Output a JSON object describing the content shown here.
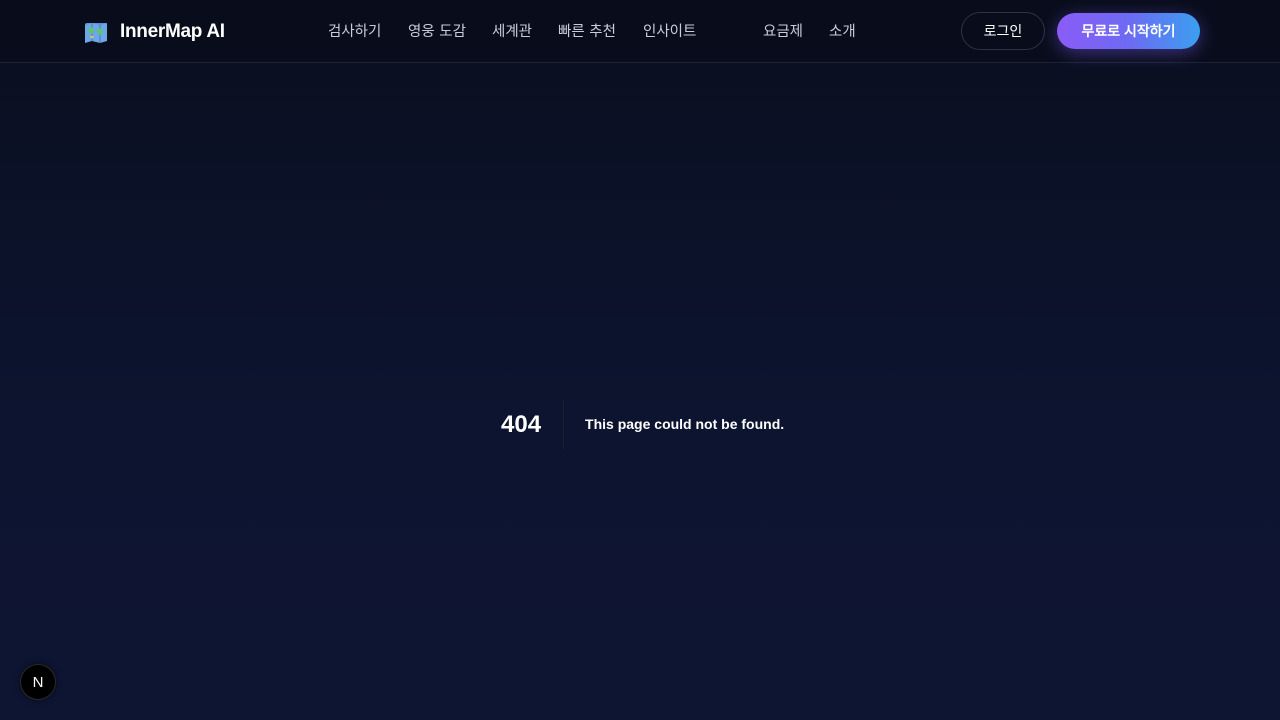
{
  "navbar": {
    "brand": {
      "icon": "world-map-icon",
      "name": "InnerMap AI"
    },
    "links": [
      {
        "label": "검사하기"
      },
      {
        "label": "영웅 도감"
      },
      {
        "label": "세계관"
      },
      {
        "label": "빠른 추천"
      },
      {
        "label": "인사이트"
      },
      {
        "label": "요금제"
      },
      {
        "label": "소개"
      }
    ],
    "login_label": "로그인",
    "cta_label": "무료로 시작하기"
  },
  "error": {
    "code": "404",
    "message": "This page could not be found."
  },
  "dev_badge": {
    "icon": "nextjs-icon",
    "letter": "N"
  },
  "colors": {
    "background": "#0a0f1f",
    "cta_gradient_start": "#8b5cf6",
    "cta_gradient_end": "#3b9ff0",
    "nav_text": "#c9cdd8"
  }
}
